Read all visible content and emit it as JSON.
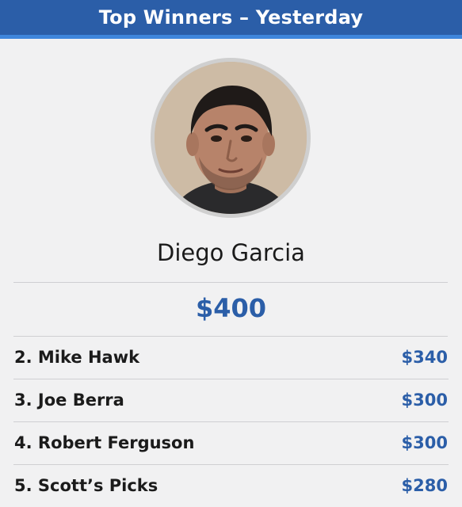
{
  "header": {
    "title": "Top Winners – Yesterday"
  },
  "winner": {
    "avatar_icon": "user-photo",
    "name": "Diego Garcia",
    "amount": "$400"
  },
  "rankings": [
    {
      "rank_name": "2. Mike Hawk",
      "amount": "$340"
    },
    {
      "rank_name": "3. Joe Berra",
      "amount": "$300"
    },
    {
      "rank_name": "4. Robert Ferguson",
      "amount": "$300"
    },
    {
      "rank_name": "5. Scott’s Picks",
      "amount": "$280"
    }
  ],
  "colors": {
    "header_bg": "#2b5ea8",
    "header_accent": "#3f86dc",
    "amount_blue": "#2b5ea8",
    "page_bg": "#f1f1f2"
  }
}
